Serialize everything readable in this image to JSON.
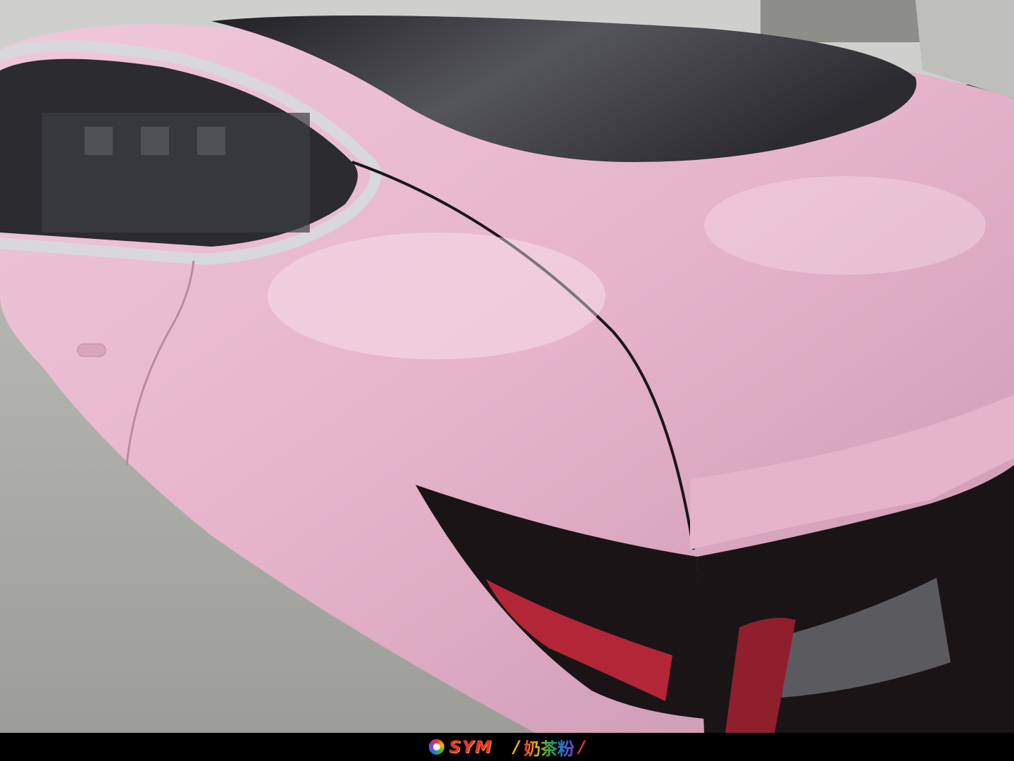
{
  "photo": {
    "subject": "pink-wrapped-car-rear-quarter",
    "colors": {
      "paint": "#e5b3ca",
      "paint_shade": "#c88fab",
      "glass": "#2b2b30",
      "chrome": "#d8d8dc",
      "taillight": "#1a1416",
      "reflector": "#b32638",
      "pavement": "#a9aaa6"
    }
  },
  "watermark": {
    "brand": "SYM",
    "separator_left": "/",
    "product": "奶茶粉",
    "separator_right": "/"
  }
}
